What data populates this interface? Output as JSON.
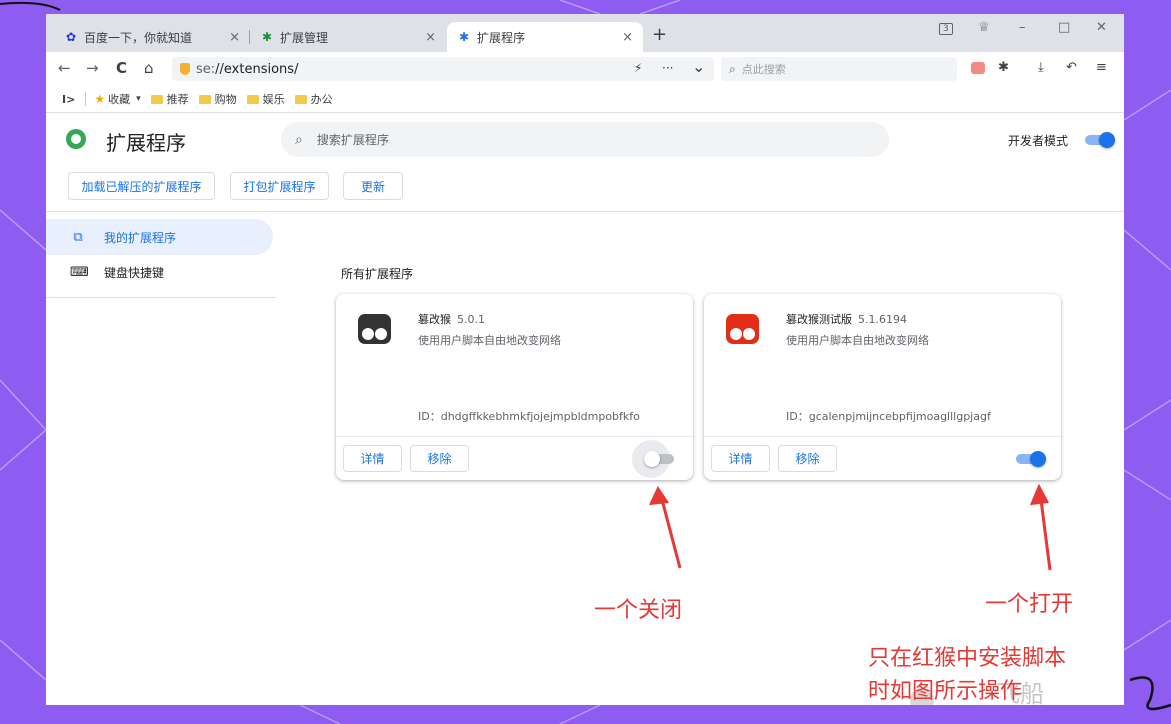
{
  "tabs": [
    {
      "icon": "baidu-icon",
      "label": "百度一下，你就知道",
      "close": "×"
    },
    {
      "icon": "puzzle-icon",
      "label": "扩展管理",
      "close": "×"
    },
    {
      "icon": "puzzle-icon",
      "label": "扩展程序",
      "close": "×"
    }
  ],
  "new_tab": "+",
  "window_controls": {
    "tab_count": "3",
    "shirt": "♕",
    "minimize": "–",
    "maximize": "□",
    "close": "✕"
  },
  "toolbar": {
    "back": "←",
    "forward": "→",
    "reload": "C",
    "home": "⌂",
    "url_prefix": "se:",
    "url_path": "//extensions/",
    "flash": "⚡",
    "more": "···",
    "dropdown": "⌄",
    "search_placeholder": "点此搜索",
    "right_icons": {
      "extensions": "✱",
      "download": "⤓",
      "undo": "↶",
      "menu": "≡"
    }
  },
  "bookmarks": {
    "toggle": "I>",
    "items": [
      {
        "label": "收藏",
        "type": "star"
      },
      {
        "label": "推荐",
        "type": "folder"
      },
      {
        "label": "购物",
        "type": "folder"
      },
      {
        "label": "娱乐",
        "type": "folder"
      },
      {
        "label": "办公",
        "type": "folder"
      }
    ],
    "caret": "▾"
  },
  "extensions_page": {
    "title": "扩展程序",
    "search_placeholder": "搜索扩展程序",
    "developer_mode_label": "开发者模式",
    "developer_mode_on": true,
    "actions": [
      "加载已解压的扩展程序",
      "打包扩展程序",
      "更新"
    ],
    "sidebar": [
      {
        "label": "我的扩展程序",
        "icon": "puzzle-outline-icon",
        "active": true
      },
      {
        "label": "键盘快捷键",
        "icon": "keyboard-icon",
        "active": false
      }
    ],
    "section_title": "所有扩展程序",
    "cards": [
      {
        "name": "篡改猴",
        "version": "5.0.1",
        "description": "使用用户脚本自由地改变网络",
        "id_text": "ID：dhdgffkkebhmkfjojejmpbldmpobfkfo",
        "details": "详情",
        "remove": "移除",
        "enabled": false,
        "icon_color": "#333333"
      },
      {
        "name": "篡改猴测试版",
        "version": "5.1.6194",
        "description": "使用用户脚本自由地改变网络",
        "id_text": "ID：gcalenpjmijncebpfijmoaglllgpjagf",
        "details": "详情",
        "remove": "移除",
        "enabled": true,
        "icon_color": "#e32d14"
      }
    ]
  },
  "annotations": {
    "off_label": "一个关闭",
    "on_label": "一个打开",
    "note_line1": "只在红猴中安装脚本",
    "note_line2": "时如图所示操作",
    "watermark": "飞船"
  },
  "colors": {
    "background": "#8e5cf0",
    "accent": "#1a73e8",
    "annotation": "#e53935"
  }
}
